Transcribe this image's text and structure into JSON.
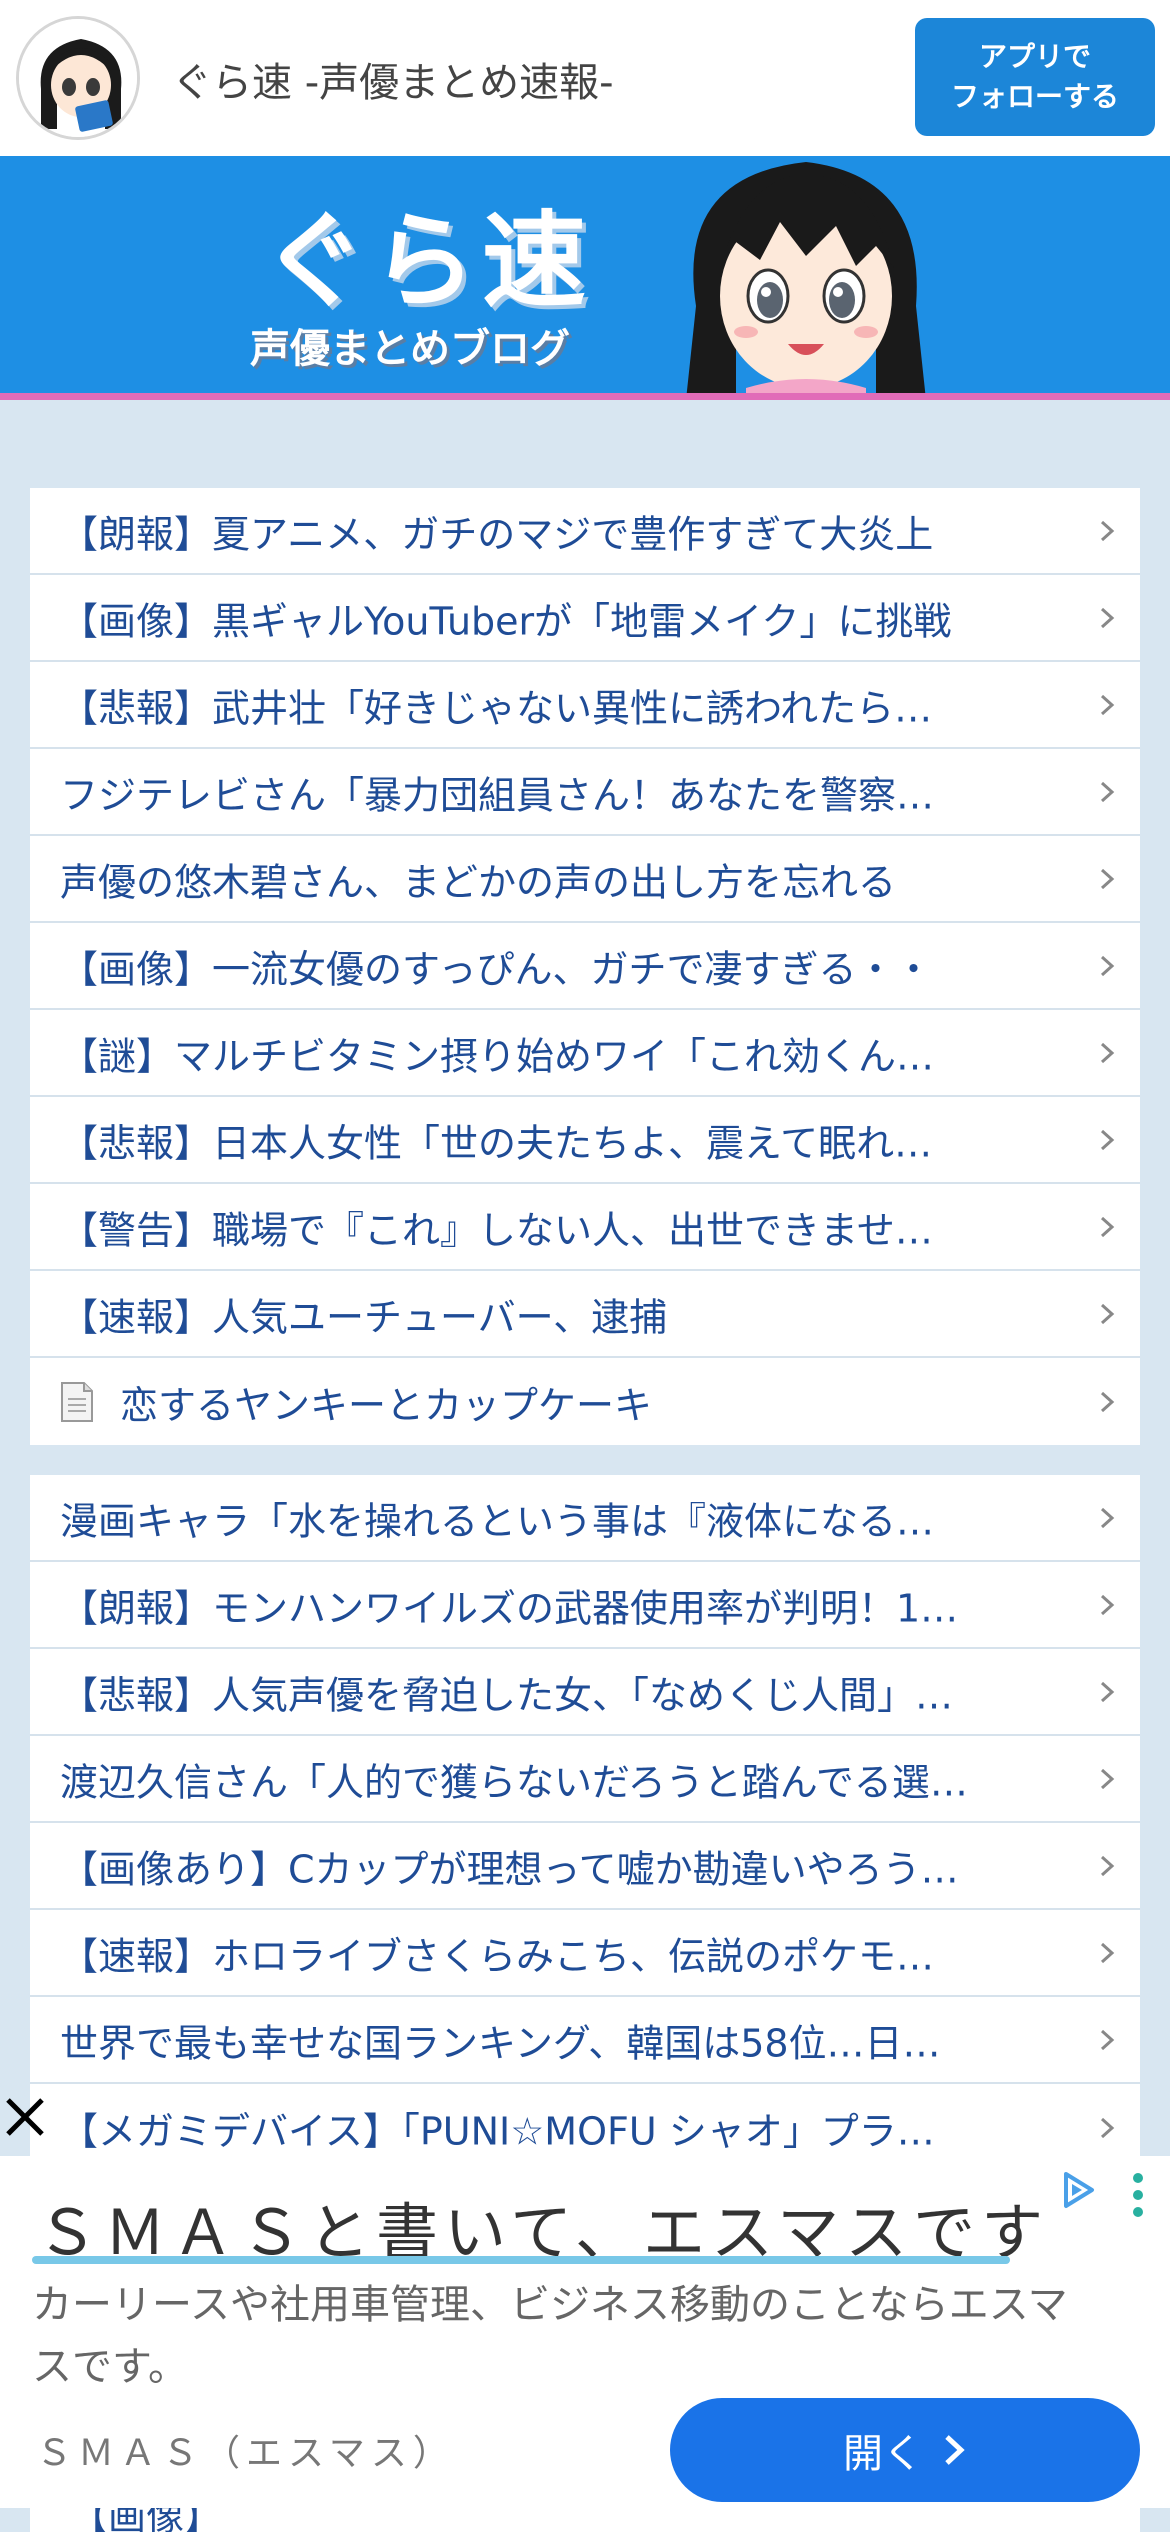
{
  "header": {
    "site_title": "ぐら速 -声優まとめ速報-",
    "follow_button_line1": "アプリで",
    "follow_button_line2": "フォローする"
  },
  "banner": {
    "logo_text": "ぐら速",
    "subtitle": "声優まとめブログ"
  },
  "list1": [
    "【朗報】夏アニメ、ガチのマジで豊作すぎて大炎上",
    "【画像】黒ギャルYouTuberが「地雷メイク」に挑戦",
    "【悲報】武井壮「好きじゃない異性に誘われたら…",
    "フジテレビさん「暴力団組員さん！あなたを警察…",
    "声優の悠木碧さん、まどかの声の出し方を忘れる",
    "【画像】一流女優のすっぴん、ガチで凄すぎる・・",
    "【謎】マルチビタミン摂り始めワイ「これ効くん…",
    "【悲報】日本人女性「世の夫たちよ、震えて眠れ…",
    "【警告】職場で『これ』しない人、出世できませ…",
    "【速報】人気ユーチューバー、逮捕"
  ],
  "list1_doc_item": "恋するヤンキーとカップケーキ",
  "list2": [
    "漫画キャラ「水を操れるという事は『液体になる…",
    "【朗報】モンハンワイルズの武器使用率が判明！1…",
    "【悲報】人気声優を脅迫した女、「なめくじ人間」…",
    "渡辺久信さん「人的で獲らないだろうと踏んでる選…",
    "【画像あり】Cカップが理想って嘘か勘違いやろう…",
    "【速報】ホロライブさくらみこち、伝説のポケモ…",
    "世界で最も幸せな国ランキング、韓国は58位…日…",
    "【メガミデバイス】「PUNI☆MOFU シャオ」プラ…"
  ],
  "peek_row": "【画像】",
  "ad": {
    "headline": "ＳＭＡＳと書いて、エスマスです",
    "description": "カーリースや社用車管理、ビジネス移動のことならエスマスです。",
    "sponsor": "ＳＭＡＳ（エスマス）",
    "open_button": "開く"
  },
  "colors": {
    "accent": "#1c86d8",
    "link_text": "#1f4c96",
    "banner_bg": "#1e8fe4",
    "banner_border": "#e16cb8",
    "page_bg": "#d8e6f1",
    "ad_button": "#1a73e8"
  },
  "icons": {
    "row_chevron": "chevron-right-icon",
    "doc": "document-icon",
    "close": "close-icon",
    "ad_choices": "ad-choices-icon",
    "ad_menu": "more-vertical-icon",
    "open_chevron": "chevron-right-icon"
  }
}
